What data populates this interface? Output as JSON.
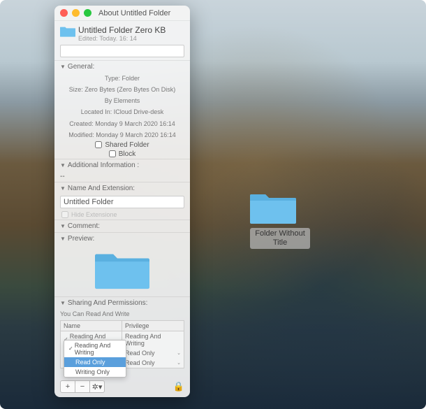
{
  "window": {
    "title": "About Untitled Folder",
    "header_name": "Untitled Folder Zero KB",
    "header_sub": "Edited: Today. 16: 14"
  },
  "general": {
    "heading": "General:",
    "type": "Type: Folder",
    "size": "Size: Zero Bytes (Zero Bytes On Disk)",
    "by": "By Elements",
    "location": "Located In: ICloud Drive-desk",
    "created": "Created: Monday 9 March 2020 16:14",
    "modified": "Modified: Monday 9 March 2020 16:14",
    "shared_label": "Shared Folder",
    "block_label": "Block"
  },
  "additional": {
    "heading": "Additional Information :",
    "value": "--"
  },
  "name_ext": {
    "heading": "Name And Extension:",
    "value": "Untitled Folder",
    "hide_label": "Hide Extensione"
  },
  "comment": {
    "heading": "Comment:"
  },
  "preview": {
    "heading": "Preview:"
  },
  "sharing": {
    "heading": "Sharing And Permissions:",
    "you_can": "You Can Read And Write",
    "col_name": "Name",
    "col_priv": "Privilege",
    "rows": [
      {
        "name": "Reading And Writing",
        "priv": "Reading And Writing"
      },
      {
        "name": "",
        "priv": "Read Only"
      },
      {
        "name": "",
        "priv": "Read Only"
      }
    ],
    "dropdown": {
      "items": [
        "Reading And Writing",
        "Read Only",
        "Writing Only"
      ],
      "selected_index": 1
    }
  },
  "desktop_folder": {
    "label": "Folder Without Title"
  },
  "colors": {
    "folder": "#6ec1ee",
    "accent": "#5a9fdc"
  },
  "icons": {
    "close": "close-icon",
    "min": "minimize-icon",
    "max": "maximize-icon",
    "triangle": "disclosure-triangle-icon",
    "chev": "chevron-icon",
    "plus": "plus-icon",
    "minus": "minus-icon",
    "gear": "gear-icon",
    "lock": "lock-icon"
  }
}
